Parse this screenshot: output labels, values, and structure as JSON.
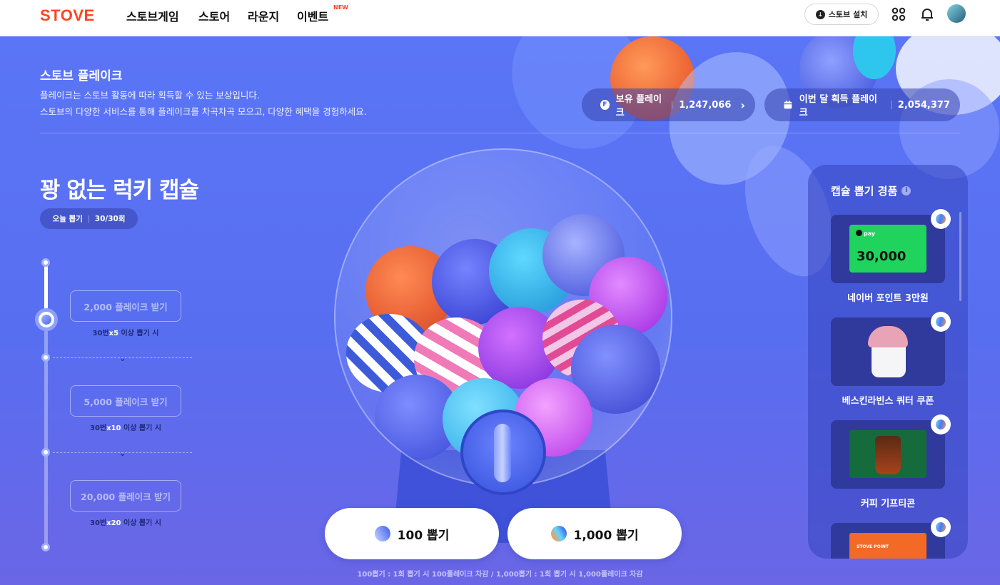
{
  "nav": {
    "logo": "STOVE",
    "items": [
      "스토브게임",
      "스토어",
      "라운지",
      "이벤트"
    ],
    "new_badge": "NEW",
    "install_label": "스토브 설치",
    "icons": [
      "apps-icon",
      "bell-icon",
      "avatar"
    ]
  },
  "header": {
    "title": "스토브 플레이크",
    "desc1": "플레이크는 스토브 활동에 따라 획득할 수 있는 보상입니다.",
    "desc2": "스토브의 다양한 서비스를 통해 플레이크를 차곡차곡 모으고, 다양한 혜택을 경험하세요.",
    "owned_label": "보유 플레이크",
    "owned_value": "1,247,066",
    "monthly_label": "이번 달 획득 플레이크",
    "monthly_value": "2,054,377"
  },
  "capsule": {
    "title": "꽝 없는 럭키 캡슐",
    "today_label": "오늘 뽑기",
    "today_value": "30/30회",
    "milestones": [
      {
        "label": "2,000 플레이크 받기",
        "cond_a": "30번",
        "cond_b": "x5",
        "cond_c": " 이상 뽑기 시"
      },
      {
        "label": "5,000 플레이크 받기",
        "cond_a": "30번",
        "cond_b": "x10",
        "cond_c": " 이상 뽑기 시"
      },
      {
        "label": "20,000 플레이크 받기",
        "cond_a": "30번",
        "cond_b": "x20",
        "cond_c": " 이상 뽑기 시"
      }
    ],
    "draw_100": "100 뽑기",
    "draw_1000": "1,000 뽑기",
    "note": "100뽑기 : 1회 뽑기 시 100플레이크 차감 / 1,000뽑기 : 1회 뽑기 시 1,000플레이크 차감"
  },
  "prizes": {
    "title": "캡슐 뽑기 경품",
    "items": [
      {
        "name": "네이버 포인트 3만원",
        "pay_label": "pay",
        "amount": "30,000"
      },
      {
        "name": "베스킨라빈스 쿼터 쿠폰"
      },
      {
        "name": "커피 기프티콘"
      },
      {
        "name": "",
        "brand": "STOVE POINT"
      }
    ]
  },
  "colors": {
    "brand": "#fc4420",
    "background": "#5b6ff0",
    "panel": "#3444be"
  }
}
